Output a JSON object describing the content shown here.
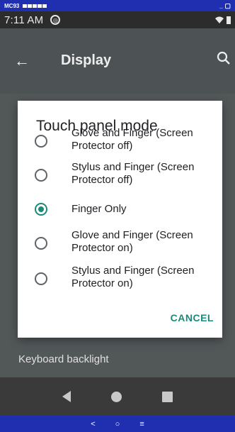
{
  "status_top": {
    "device": "MC93"
  },
  "android_status": {
    "time": "7:11 AM"
  },
  "appbar": {
    "title": "Display",
    "back_icon": "arrow-left-icon",
    "search_icon": "search-icon"
  },
  "background": {
    "keyboard_backlight": "Keyboard backlight"
  },
  "dialog": {
    "title": "Touch panel mode",
    "options": [
      {
        "label": "Glove and Finger (Screen Protector off)",
        "selected": false
      },
      {
        "label": "Stylus and Finger (Screen Protector off)",
        "selected": false
      },
      {
        "label": "Finger Only",
        "selected": true
      },
      {
        "label": "Glove and Finger (Screen Protector on)",
        "selected": false
      },
      {
        "label": "Stylus and Finger (Screen Protector on)",
        "selected": false
      }
    ],
    "cancel": "CANCEL"
  },
  "bottom_bar": {
    "back": "<",
    "home": "○",
    "menu": "≡"
  },
  "colors": {
    "accent": "#1b8a78",
    "bar_blue": "#1f2fb0"
  }
}
